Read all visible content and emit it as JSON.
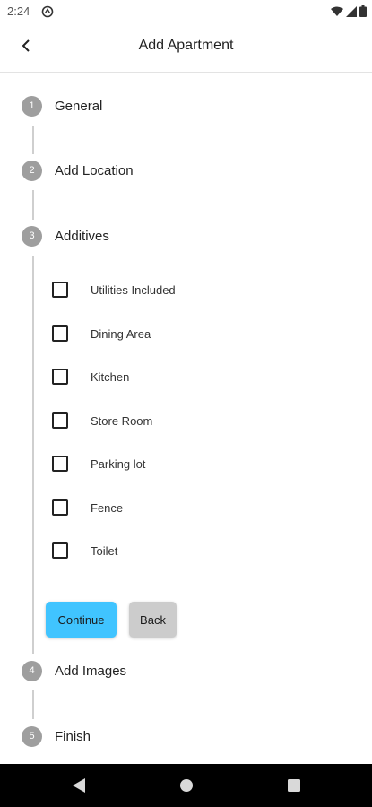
{
  "status_bar": {
    "time": "2:24",
    "icons": [
      "sync-icon",
      "wifi-icon",
      "signal-icon",
      "battery-icon"
    ]
  },
  "app_bar": {
    "title": "Add Apartment",
    "back_icon": "arrow-back-icon"
  },
  "stepper": {
    "steps": [
      {
        "number": "1",
        "title": "General"
      },
      {
        "number": "2",
        "title": "Add Location"
      },
      {
        "number": "3",
        "title": "Additives"
      },
      {
        "number": "4",
        "title": "Add Images"
      },
      {
        "number": "5",
        "title": "Finish"
      }
    ],
    "active_step": 3,
    "additives": [
      {
        "label": "Utilities Included",
        "checked": false
      },
      {
        "label": "Dining Area",
        "checked": false
      },
      {
        "label": "Kitchen",
        "checked": false
      },
      {
        "label": "Store Room",
        "checked": false
      },
      {
        "label": "Parking lot",
        "checked": false
      },
      {
        "label": "Fence",
        "checked": false
      },
      {
        "label": "Toilet",
        "checked": false
      }
    ],
    "continue_label": "Continue",
    "back_label": "Back"
  },
  "nav_bar": {
    "icons": [
      "nav-back-icon",
      "nav-home-icon",
      "nav-recents-icon"
    ]
  },
  "colors": {
    "accent": "#40c4ff",
    "step_circle": "#9e9e9e",
    "back_button": "#cccccc",
    "nav_bar": "#000000"
  }
}
